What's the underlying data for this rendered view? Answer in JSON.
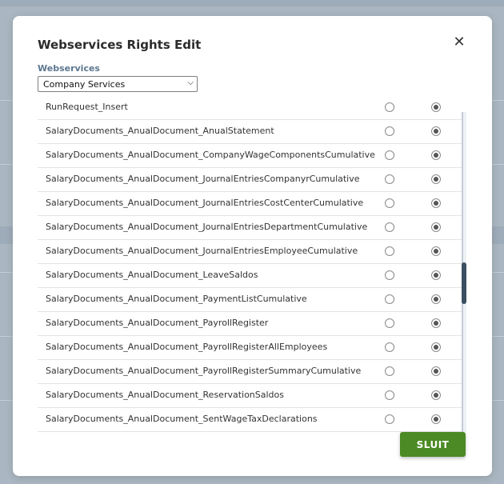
{
  "dialog": {
    "title": "Webservices Rights Edit",
    "close_icon": "close-icon",
    "webservices_label": "Webservices",
    "select": {
      "value": "Company Services",
      "options": [
        "Company Services"
      ]
    },
    "close_button_label": "SLUIT",
    "close_button_color": "#4b8a24"
  },
  "rows": [
    {
      "label": "RunRequest_Insert",
      "option1_checked": false,
      "option2_checked": true
    },
    {
      "label": "SalaryDocuments_AnualDocument_AnualStatement",
      "option1_checked": false,
      "option2_checked": true
    },
    {
      "label": "SalaryDocuments_AnualDocument_CompanyWageComponentsCumulative",
      "option1_checked": false,
      "option2_checked": true
    },
    {
      "label": "SalaryDocuments_AnualDocument_JournalEntriesCompanyrCumulative",
      "option1_checked": false,
      "option2_checked": true
    },
    {
      "label": "SalaryDocuments_AnualDocument_JournalEntriesCostCenterCumulative",
      "option1_checked": false,
      "option2_checked": true
    },
    {
      "label": "SalaryDocuments_AnualDocument_JournalEntriesDepartmentCumulative",
      "option1_checked": false,
      "option2_checked": true
    },
    {
      "label": "SalaryDocuments_AnualDocument_JournalEntriesEmployeeCumulative",
      "option1_checked": false,
      "option2_checked": true
    },
    {
      "label": "SalaryDocuments_AnualDocument_LeaveSaldos",
      "option1_checked": false,
      "option2_checked": true
    },
    {
      "label": "SalaryDocuments_AnualDocument_PaymentListCumulative",
      "option1_checked": false,
      "option2_checked": true
    },
    {
      "label": "SalaryDocuments_AnualDocument_PayrollRegister",
      "option1_checked": false,
      "option2_checked": true
    },
    {
      "label": "SalaryDocuments_AnualDocument_PayrollRegisterAllEmployees",
      "option1_checked": false,
      "option2_checked": true
    },
    {
      "label": "SalaryDocuments_AnualDocument_PayrollRegisterSummaryCumulative",
      "option1_checked": false,
      "option2_checked": true
    },
    {
      "label": "SalaryDocuments_AnualDocument_ReservationSaldos",
      "option1_checked": false,
      "option2_checked": true
    },
    {
      "label": "SalaryDocuments_AnualDocument_SentWageTaxDeclarations",
      "option1_checked": false,
      "option2_checked": true
    }
  ]
}
